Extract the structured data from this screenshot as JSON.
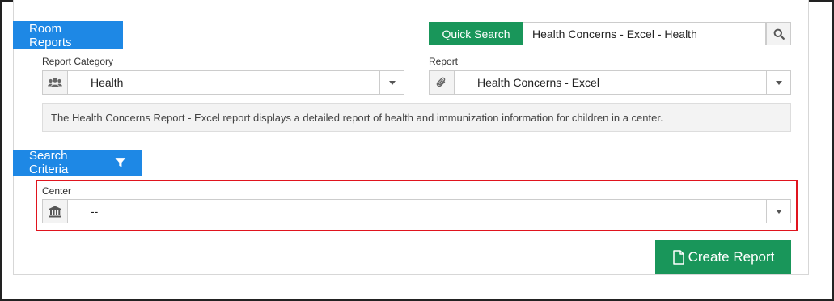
{
  "room_reports": {
    "label": "Room Reports"
  },
  "quick_search": {
    "button_label": "Quick Search",
    "value": "Health Concerns - Excel - Health",
    "icon": "search-icon"
  },
  "report_category": {
    "label": "Report Category",
    "value": "Health",
    "icon": "users-icon"
  },
  "report": {
    "label": "Report",
    "value": "Health Concerns - Excel",
    "icon": "paperclip-icon"
  },
  "description": "The Health Concerns Report - Excel report displays a detailed report of health and immunization information for children in a center.",
  "search_criteria": {
    "label": "Search Criteria",
    "icon": "filter-icon"
  },
  "center": {
    "label": "Center",
    "value": "--",
    "icon": "bank-icon"
  },
  "create_report": {
    "label": "Create Report",
    "icon": "document-icon"
  },
  "colors": {
    "primary_blue": "#1e88e5",
    "success_green": "#19965a",
    "highlight_red": "#e0141e"
  }
}
